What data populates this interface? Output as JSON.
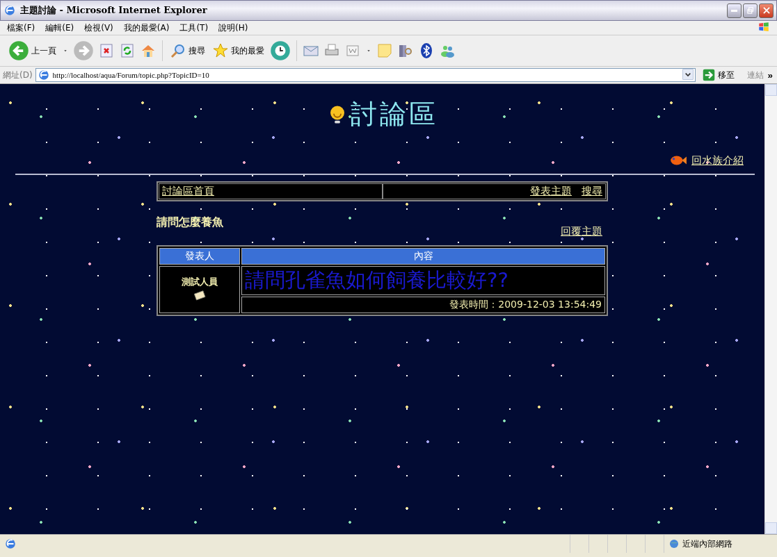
{
  "window": {
    "title": "主題討論 - Microsoft Internet Explorer"
  },
  "menu": [
    "檔案(F)",
    "編輯(E)",
    "檢視(V)",
    "我的最愛(A)",
    "工具(T)",
    "說明(H)"
  ],
  "toolbar": {
    "back": "上一頁",
    "search": "搜尋",
    "favorites": "我的最愛"
  },
  "address_bar": {
    "label": "網址(D)",
    "url": "http://localhost/aqua/Forum/topic.php?TopicID=10",
    "go": "移至",
    "links": "連結",
    "more": "»"
  },
  "page": {
    "heading": "討論區",
    "aqua_link": "回水族介紹",
    "nav": {
      "home": "討論區首頁",
      "actions": [
        "發表主題",
        "搜尋"
      ]
    },
    "topic_title": "請問怎麼養魚",
    "reply_link": "回覆主題",
    "post_table": {
      "columns": [
        "發表人",
        "內容"
      ],
      "rows": [
        {
          "author": "測試人員",
          "content": "請問孔雀魚如何飼養比較好??",
          "posted": "發表時間：2009-12-03 13:54:49"
        }
      ]
    }
  },
  "status_bar": {
    "zone": "近端內部網路"
  }
}
